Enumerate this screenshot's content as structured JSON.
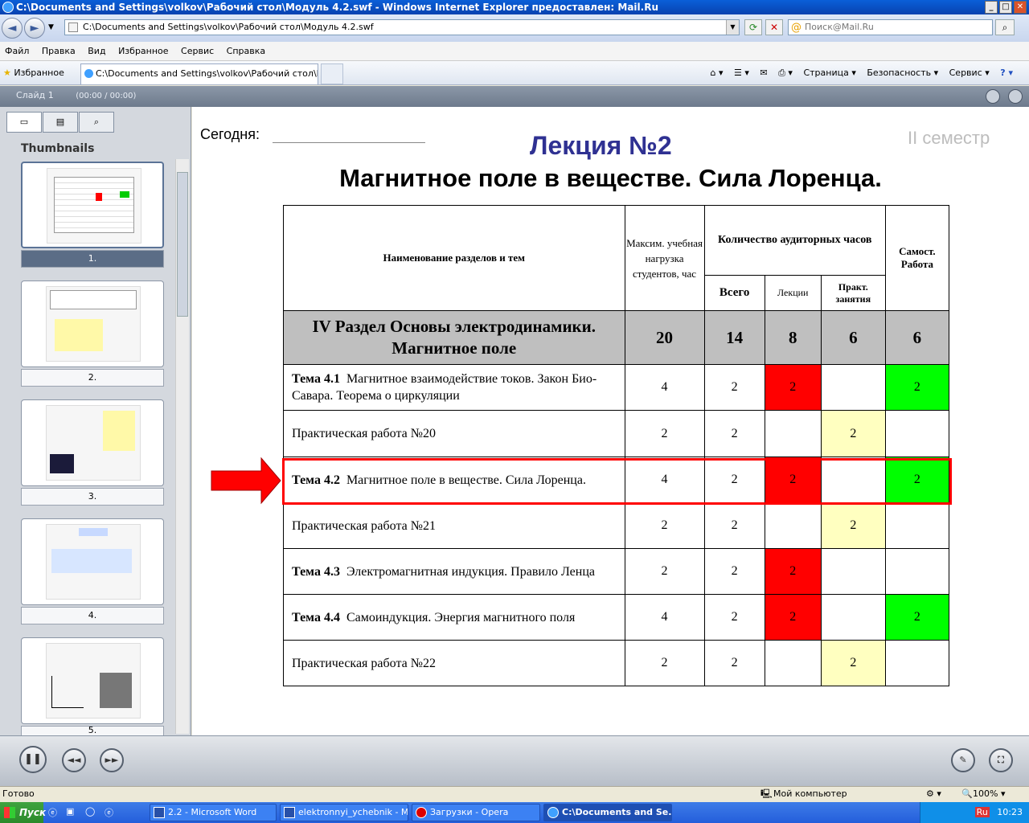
{
  "window": {
    "title": "C:\\Documents and Settings\\volkov\\Рабочий стол\\Модуль 4.2.swf - Windows Internet Explorer предоставлен: Mail.Ru",
    "min": "_",
    "max": "□",
    "close": "✕"
  },
  "address": {
    "url": "C:\\Documents and Settings\\volkov\\Рабочий стол\\Модуль 4.2.swf",
    "search_placeholder": "Поиск@Mail.Ru"
  },
  "menu": [
    "Файл",
    "Правка",
    "Вид",
    "Избранное",
    "Сервис",
    "Справка"
  ],
  "tabs": {
    "favorites": "Избранное",
    "active_tab": "C:\\Documents and Settings\\volkov\\Рабочий стол\\Мо..."
  },
  "commandbar": {
    "page": "Страница ▾",
    "security": "Безопасность ▾",
    "tools": "Сервис ▾"
  },
  "player": {
    "slide_label": "Слайд 1",
    "time": "(00:00 / 00:00)"
  },
  "sidebar": {
    "title": "Thumbnails",
    "labels": [
      "1.",
      "2.",
      "3.",
      "4.",
      "5."
    ]
  },
  "slide": {
    "today_label": "Сегодня:",
    "semester": "II семестр",
    "lecture": "Лекция №2",
    "heading": "Магнитное поле в веществе. Сила Лоренца.",
    "table": {
      "headers": {
        "name": "Наименование разделов и тем",
        "max_load": "Максим. учебная нагрузка студентов, час",
        "aud_hours": "Количество аудиторных часов",
        "self": "Самост. Работа",
        "total": "Всего",
        "lectures": "Лекции",
        "practice": "Практ. занятия"
      },
      "section": {
        "name": "IV Раздел Основы электродинамики. Магнитное поле",
        "max": "20",
        "total": "14",
        "lect": "8",
        "prac": "6",
        "self": "6"
      },
      "rows": [
        {
          "topic": "Тема 4.1",
          "text": "Магнитное взаимодействие токов. Закон Био-Савара. Теорема о циркуляции",
          "max": "4",
          "total": "2",
          "lect": "2",
          "prac": "",
          "self": "2"
        },
        {
          "topic": "",
          "text": "Практическая работа №20",
          "max": "2",
          "total": "2",
          "lect": "",
          "prac": "2",
          "self": ""
        },
        {
          "topic": "Тема 4.2",
          "text": "Магнитное поле в веществе. Сила Лоренца.",
          "max": "4",
          "total": "2",
          "lect": "2",
          "prac": "",
          "self": "2"
        },
        {
          "topic": "",
          "text": "Практическая работа №21",
          "max": "2",
          "total": "2",
          "lect": "",
          "prac": "2",
          "self": ""
        },
        {
          "topic": "Тема 4.3",
          "text": "Электромагнитная индукция. Правило Ленца",
          "max": "2",
          "total": "2",
          "lect": "2",
          "prac": "",
          "self": ""
        },
        {
          "topic": "Тема 4.4",
          "text": "Самоиндукция. Энергия магнитного поля",
          "max": "4",
          "total": "2",
          "lect": "2",
          "prac": "",
          "self": "2"
        },
        {
          "topic": "",
          "text": "Практическая работа №22",
          "max": "2",
          "total": "2",
          "lect": "",
          "prac": "2",
          "self": ""
        }
      ]
    }
  },
  "colors": {
    "lecture": "#2f3192",
    "red": "#ff0000",
    "green": "#00ff00",
    "yellow": "#ffffc0"
  },
  "status": {
    "ready": "Готово",
    "zone": "Мой компьютер",
    "zoom": "100%"
  },
  "taskbar": {
    "start": "Пуск",
    "items": [
      "2.2 - Microsoft Word",
      "elektronnyi_ychebnik - M...",
      "Загрузки - Opera",
      "C:\\Documents and Se..."
    ],
    "lang": "Ru",
    "clock": "10:23"
  }
}
